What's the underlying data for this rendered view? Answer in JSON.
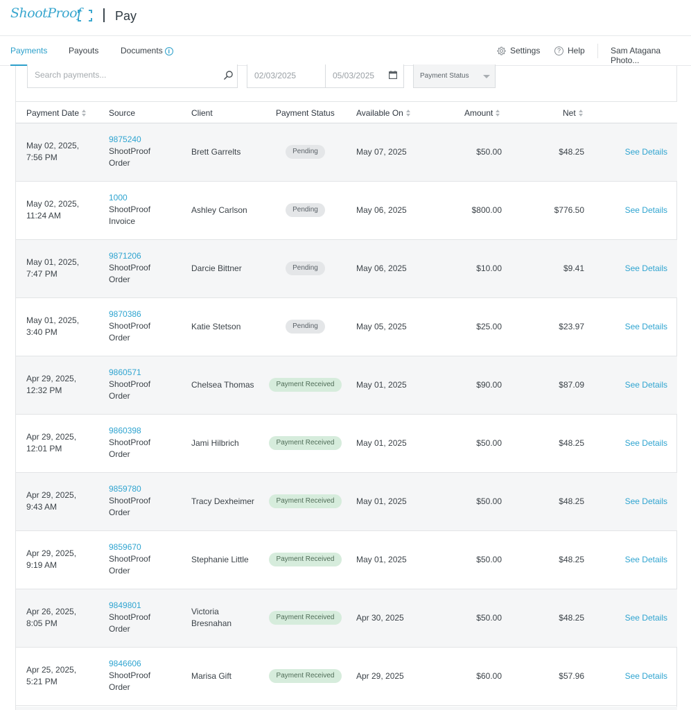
{
  "header": {
    "logo_text": "ShootProof",
    "product": "Pay"
  },
  "nav": {
    "tabs": [
      {
        "label": "Payments",
        "active": true
      },
      {
        "label": "Payouts",
        "active": false
      },
      {
        "label": "Documents",
        "active": false
      }
    ],
    "settings_label": "Settings",
    "help_label": "Help",
    "account_label": "Sam Atagana Photo..."
  },
  "filters": {
    "search_placeholder": "Search payments...",
    "start_date": "02/03/2025",
    "end_date": "05/03/2025",
    "status_label": "Payment Status"
  },
  "table": {
    "columns": [
      "Payment Date",
      "Source",
      "Client",
      "Payment Status",
      "Available On",
      "Amount",
      "Net"
    ],
    "rows": [
      {
        "date": "May 02, 2025,",
        "time": "7:56 PM",
        "id": "9875240",
        "src1": "ShootProof",
        "src2": "Order",
        "client": "Brett Garrelts",
        "client2": "",
        "status": "Pending",
        "available": "May 07, 2025",
        "amount": "$50.00",
        "net": "$48.25",
        "action": "See Details"
      },
      {
        "date": "May 02, 2025,",
        "time": "11:24 AM",
        "id": "1000",
        "src1": "ShootProof",
        "src2": "Invoice",
        "client": "Ashley Carlson",
        "client2": "",
        "status": "Pending",
        "available": "May 06, 2025",
        "amount": "$800.00",
        "net": "$776.50",
        "action": "See Details"
      },
      {
        "date": "May 01, 2025,",
        "time": "7:47 PM",
        "id": "9871206",
        "src1": "ShootProof",
        "src2": "Order",
        "client": "Darcie Bittner",
        "client2": "",
        "status": "Pending",
        "available": "May 06, 2025",
        "amount": "$10.00",
        "net": "$9.41",
        "action": "See Details"
      },
      {
        "date": "May 01, 2025,",
        "time": "3:40 PM",
        "id": "9870386",
        "src1": "ShootProof",
        "src2": "Order",
        "client": "Katie Stetson",
        "client2": "",
        "status": "Pending",
        "available": "May 05, 2025",
        "amount": "$25.00",
        "net": "$23.97",
        "action": "See Details"
      },
      {
        "date": "Apr 29, 2025,",
        "time": "12:32 PM",
        "id": "9860571",
        "src1": "ShootProof",
        "src2": "Order",
        "client": "Chelsea Thomas",
        "client2": "",
        "status": "Payment Received",
        "available": "May 01, 2025",
        "amount": "$90.00",
        "net": "$87.09",
        "action": "See Details"
      },
      {
        "date": "Apr 29, 2025,",
        "time": "12:01 PM",
        "id": "9860398",
        "src1": "ShootProof",
        "src2": "Order",
        "client": "Jami Hilbrich",
        "client2": "",
        "status": "Payment Received",
        "available": "May 01, 2025",
        "amount": "$50.00",
        "net": "$48.25",
        "action": "See Details"
      },
      {
        "date": "Apr 29, 2025,",
        "time": "9:43 AM",
        "id": "9859780",
        "src1": "ShootProof",
        "src2": "Order",
        "client": "Tracy Dexheimer",
        "client2": "",
        "status": "Payment Received",
        "available": "May 01, 2025",
        "amount": "$50.00",
        "net": "$48.25",
        "action": "See Details"
      },
      {
        "date": "Apr 29, 2025,",
        "time": "9:19 AM",
        "id": "9859670",
        "src1": "ShootProof",
        "src2": "Order",
        "client": "Stephanie Little",
        "client2": "",
        "status": "Payment Received",
        "available": "May 01, 2025",
        "amount": "$50.00",
        "net": "$48.25",
        "action": "See Details"
      },
      {
        "date": "Apr 26, 2025,",
        "time": "8:05 PM",
        "id": "9849801",
        "src1": "ShootProof",
        "src2": "Order",
        "client": "Victoria",
        "client2": "Bresnahan",
        "status": "Payment Received",
        "available": "Apr 30, 2025",
        "amount": "$50.00",
        "net": "$48.25",
        "action": "See Details"
      },
      {
        "date": "Apr 25, 2025,",
        "time": "5:21 PM",
        "id": "9846606",
        "src1": "ShootProof",
        "src2": "Order",
        "client": "Marisa Gift",
        "client2": "",
        "status": "Payment Received",
        "available": "Apr 29, 2025",
        "amount": "$60.00",
        "net": "$57.96",
        "action": "See Details"
      }
    ]
  },
  "colors": {
    "accent": "#2fa4d0",
    "pending_badge": "#e4e6e8",
    "received_badge": "#d6ecdc",
    "row_alt": "#f5f6f7"
  }
}
